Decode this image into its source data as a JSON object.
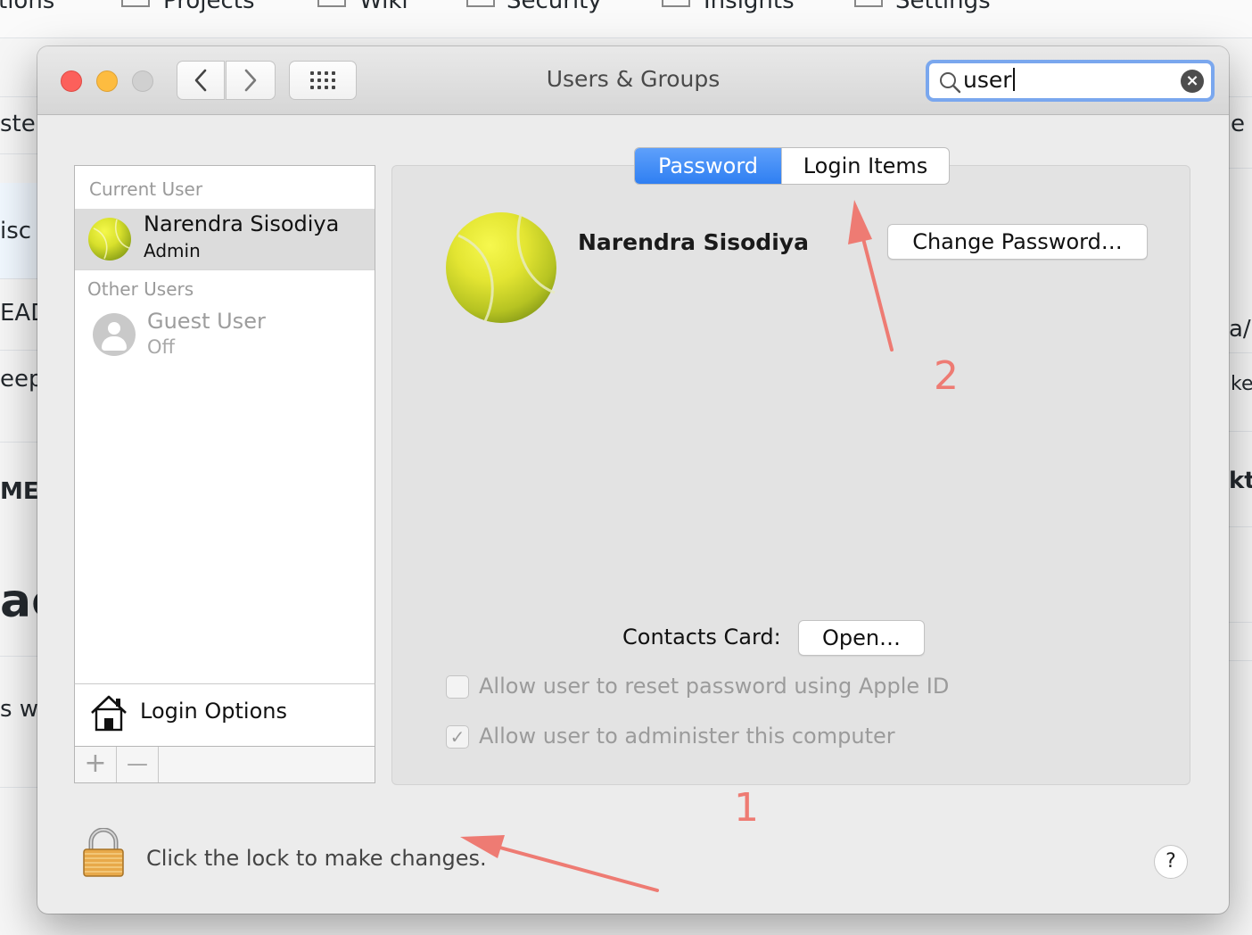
{
  "background_page": {
    "nav_items": [
      "tions",
      "Projects",
      "Wiki",
      "Security",
      "Insights",
      "Settings"
    ],
    "left_fragments": [
      "ste",
      "isc",
      "EAD",
      "eep",
      "ME.",
      "ac",
      "s wi"
    ],
    "right_fragments": [
      "e",
      "a/",
      "ke",
      "kt"
    ]
  },
  "window": {
    "title": "Users & Groups",
    "toolbar": {
      "back_icon": "chevron-left-icon",
      "forward_icon": "chevron-right-icon",
      "grid_icon": "show-all-grid-icon"
    },
    "search": {
      "value": "user",
      "search_icon": "magnifier-icon",
      "clear_icon": "clear-circle-icon"
    }
  },
  "sidebar": {
    "current_user_header": "Current User",
    "current_user": {
      "name": "Narendra Sisodiya",
      "role": "Admin"
    },
    "other_users_header": "Other Users",
    "other_users": [
      {
        "name": "Guest User",
        "status": "Off"
      }
    ],
    "login_options_label": "Login Options",
    "add_label": "+",
    "remove_label": "—"
  },
  "main": {
    "tabs": [
      {
        "label": "Password",
        "active": true
      },
      {
        "label": "Login Items",
        "active": false
      }
    ],
    "user_name": "Narendra Sisodiya",
    "change_password_label": "Change Password…",
    "contacts_card_label": "Contacts Card:",
    "open_label": "Open…",
    "checkboxes": [
      {
        "label": "Allow user to reset password using Apple ID",
        "checked": false
      },
      {
        "label": "Allow user to administer this computer",
        "checked": true
      }
    ]
  },
  "footer": {
    "lock_text": "Click the lock to make changes.",
    "help_label": "?"
  },
  "annotations": {
    "marker_1": "1",
    "marker_2": "2",
    "color": "#ee7b73"
  },
  "colors": {
    "accent": "#2f7ff2",
    "search_focus": "#7aa7ee",
    "annotation": "#ee7b73"
  }
}
